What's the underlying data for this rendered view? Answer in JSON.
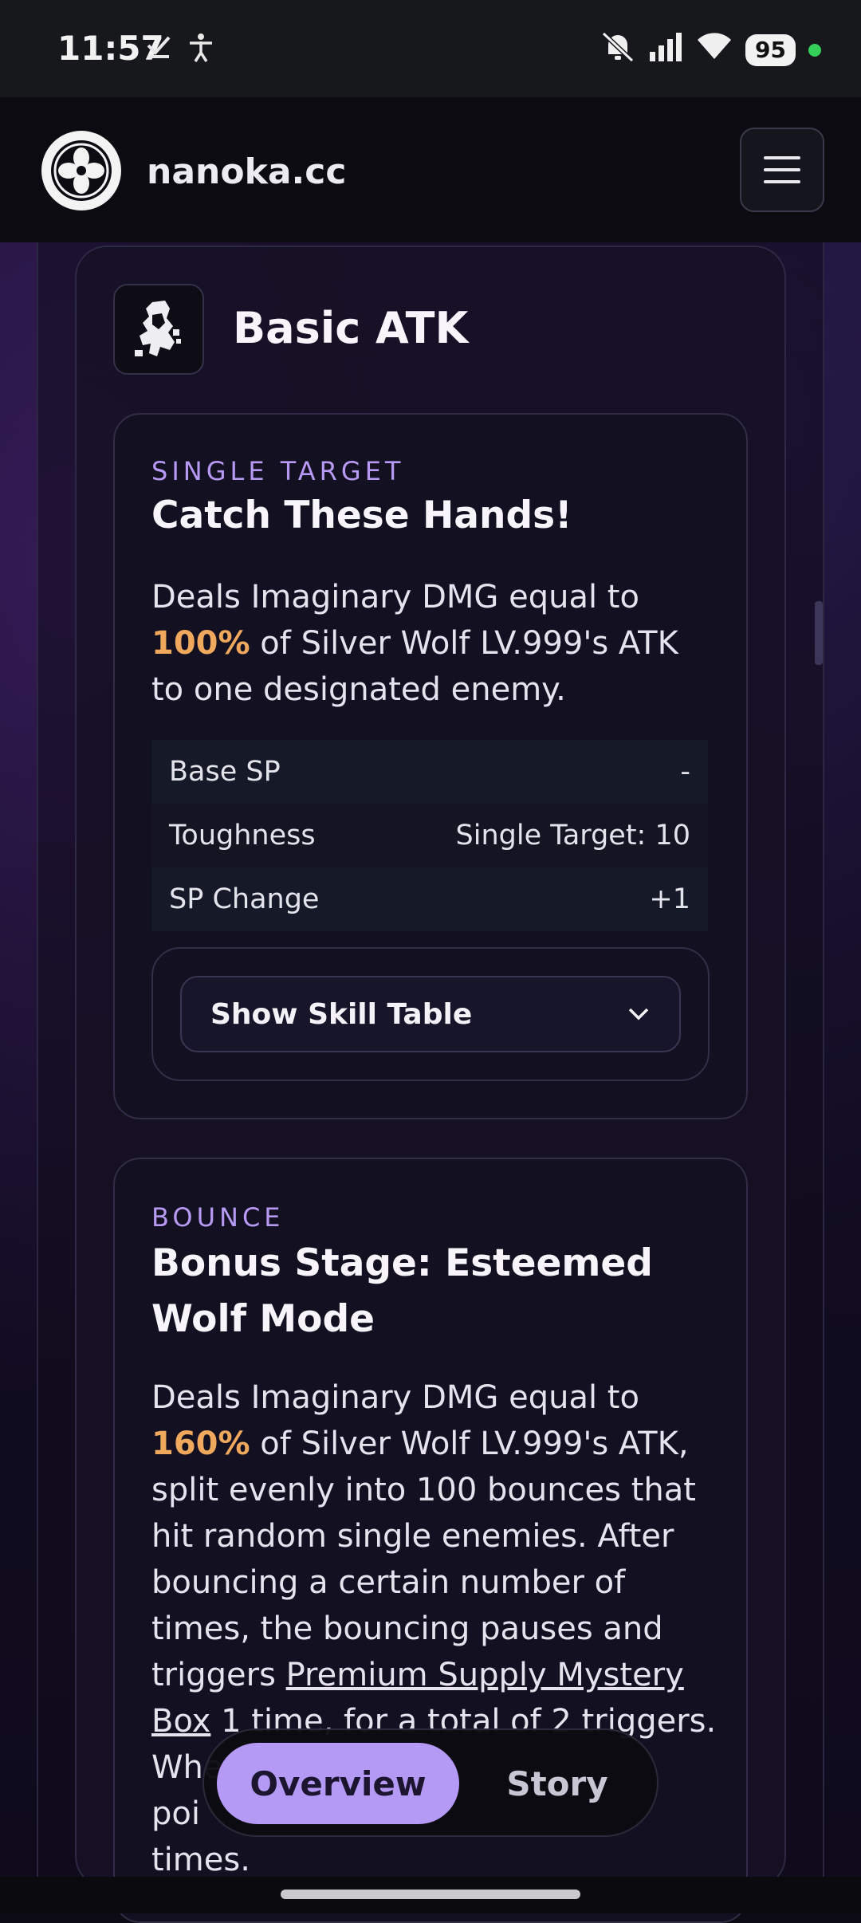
{
  "status_bar": {
    "time": "11:57",
    "left_icons": [
      "check-icon",
      "person-icon"
    ],
    "right_icons": [
      "mute-icon",
      "signal-icon",
      "wifi-icon"
    ],
    "battery": "95"
  },
  "header": {
    "site_name": "nanoka.cc",
    "logo_icon": "clover-logo-icon",
    "menu_icon": "hamburger-menu-icon"
  },
  "section": {
    "title": "Basic ATK",
    "icon": "basic-atk-icon"
  },
  "skills": [
    {
      "type": "SINGLE TARGET",
      "name": "Catch These Hands!",
      "desc_pre": "Deals Imaginary DMG equal to ",
      "desc_hl": "100%",
      "desc_post": " of Silver Wolf LV.999's ATK to one designated enemy.",
      "stats": [
        {
          "label": "Base SP",
          "value": "-"
        },
        {
          "label": "Toughness",
          "value": "Single Target: 10"
        },
        {
          "label": "SP Change",
          "value": "+1"
        }
      ],
      "table_button": "Show Skill Table"
    },
    {
      "type": "BOUNCE",
      "name": "Bonus Stage: Esteemed Wolf Mode",
      "desc_pre": "Deals Imaginary DMG equal to ",
      "desc_hl": "160%",
      "desc_mid": " of Silver Wolf LV.999's ATK, split evenly into 100 bounces that hit random single enemies. After bouncing a certain number of times, the bouncing pauses and triggers ",
      "desc_link": "Premium Supply Mystery Box",
      "desc_post": " 1 time, for a total of 2 triggers. When \"Hi",
      "desc_tail1": "poi",
      "desc_tail2": "times."
    }
  ],
  "tabs": {
    "overview": "Overview",
    "story": "Story"
  }
}
